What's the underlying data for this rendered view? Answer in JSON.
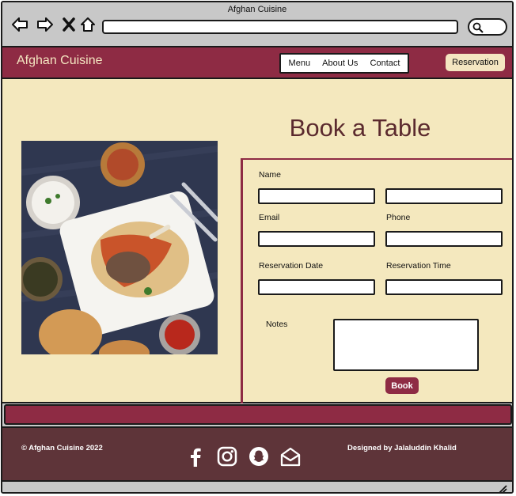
{
  "window": {
    "title": "Afghan Cuisine"
  },
  "browser": {
    "icons": [
      "back-arrow-icon",
      "forward-arrow-icon",
      "close-x-icon",
      "home-icon",
      "search-icon"
    ]
  },
  "header": {
    "logo": "Afghan Cuisine",
    "nav": [
      "Menu",
      "About Us",
      "Contact"
    ],
    "reservation_button": "Reservation"
  },
  "main": {
    "title": "Book a Table",
    "image_alt": "afghan-dish-photo",
    "form": {
      "name_label": "Name",
      "email_label": "Email",
      "phone_label": "Phone",
      "date_label": "Reservation Date",
      "time_label": "Reservation Time",
      "notes_label": "Notes",
      "submit_label": "Book"
    }
  },
  "footer": {
    "copyright": "© Afghan Cuisine 2022",
    "credit": "Designed by Jalaluddin Khalid",
    "social_icons": [
      "facebook-icon",
      "instagram-icon",
      "snapchat-icon",
      "email-icon"
    ]
  },
  "colors": {
    "brand": "#8e2b44",
    "cream": "#f4e8be",
    "footer": "#5e3439",
    "chrome": "#c8c8c8"
  }
}
